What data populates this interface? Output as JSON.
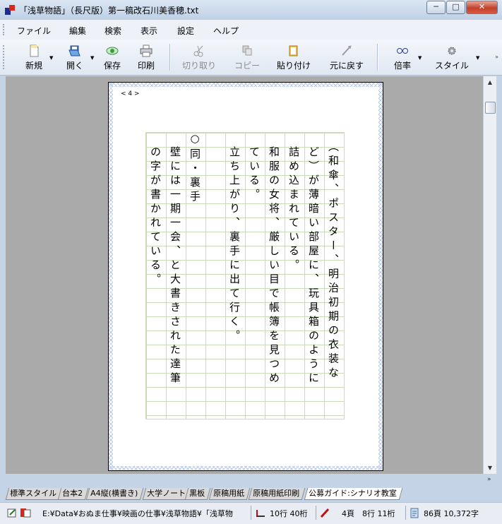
{
  "window": {
    "title": "「浅草物語」（長尺版）第一稿改石川美香穂.txt",
    "minimize": "─",
    "maximize": "□",
    "close": "✕"
  },
  "menu": [
    "ファイル",
    "編集",
    "検索",
    "表示",
    "設定",
    "ヘルプ"
  ],
  "toolbar": {
    "new": "新規",
    "open": "開く",
    "save": "保存",
    "print": "印刷",
    "cut": "切り取り",
    "copy": "コピー",
    "paste": "貼り付け",
    "undo": "元に戻す",
    "zoom": "倍率",
    "style": "スタイル"
  },
  "document": {
    "page_number": "< 4 >",
    "columns": [
      "　（和傘、ポスター、明治初期の衣装な",
      "　ど）が薄暗い部屋に、玩具箱のように",
      "　詰め込まれている。",
      "　和服の女将、厳しい目で帳簿を見つめ",
      "　ている。",
      "　立ち上がり、裏手に出て行く。",
      "",
      "○同・裏手",
      "　壁には一期一会、と大書きされた達筆",
      "　の字が書かれている。"
    ]
  },
  "tabs": [
    "標準スタイル",
    "台本2",
    "A4縦(横書き)",
    "大学ノート",
    "黒板",
    "原稿用紙",
    "原稿用紙印刷",
    "公募ガイド:シナリオ教室"
  ],
  "active_tab": "公募ガイド:シナリオ教室",
  "status": {
    "path": "E:¥Data¥おぬま仕事¥映画の仕事¥浅草物語¥「浅草物",
    "lines_cols": "10行 40桁",
    "position": "4頁　8行 11桁",
    "totals": "86頁 10,372字"
  },
  "colors": {
    "grid": "#c8ddb6",
    "page_bg": "#ffffff",
    "doc_bg": "#aaaaaa",
    "chrome": "#c4d3e6"
  }
}
